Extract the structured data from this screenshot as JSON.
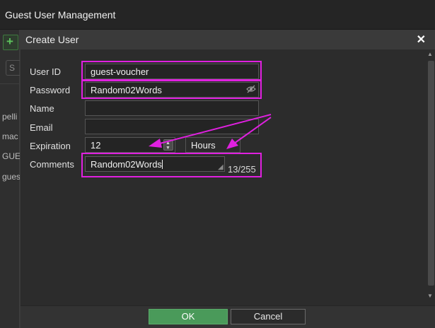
{
  "window": {
    "title": "Guest User Management"
  },
  "background": {
    "add_icon": "plus-icon",
    "search_placeholder_fragment": "S",
    "rows": [
      "pelli",
      "mac",
      "GUE",
      "gues"
    ]
  },
  "dialog": {
    "title": "Create User",
    "close_icon": "close-icon",
    "fields": {
      "user_id": {
        "label": "User ID",
        "value": "guest-voucher"
      },
      "password": {
        "label": "Password",
        "value": "Random02Words",
        "toggle_icon": "eye-slash-icon"
      },
      "name": {
        "label": "Name",
        "value": ""
      },
      "email": {
        "label": "Email",
        "value": ""
      },
      "expiration": {
        "label": "Expiration",
        "value": "12",
        "unit": "Hours"
      },
      "comments": {
        "label": "Comments",
        "value": "Random02Words",
        "counter": "13/255"
      }
    },
    "buttons": {
      "ok": "OK",
      "cancel": "Cancel"
    }
  },
  "colors": {
    "highlight": "#e020e0",
    "ok_button": "#4a9a5a",
    "add_icon": "#5ec35e"
  }
}
